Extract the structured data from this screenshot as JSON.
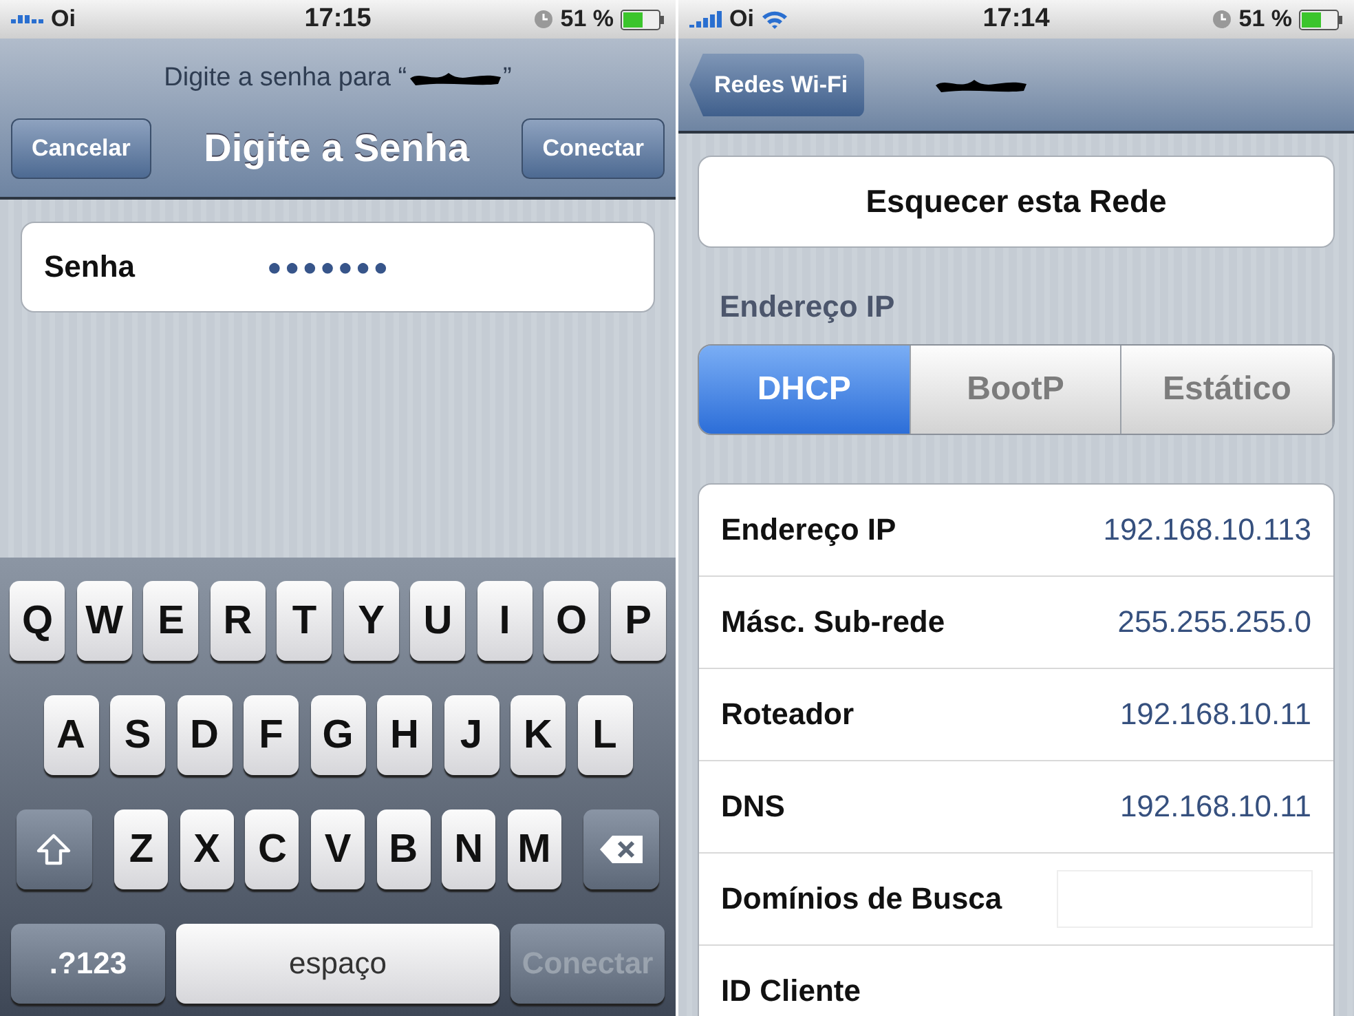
{
  "left_screen": {
    "status_bar": {
      "carrier": "Oi",
      "wifi": false,
      "time": "17:15",
      "battery": "51 %"
    },
    "nav": {
      "prompt_before": "Digite a senha para “",
      "prompt_after": "”",
      "title": "Digite a Senha",
      "left_button": "Cancelar",
      "right_button": "Conectar"
    },
    "password": {
      "label": "Senha",
      "value": "●●●●●●●"
    },
    "keyboard": {
      "rows": [
        [
          "Q",
          "W",
          "E",
          "R",
          "T",
          "Y",
          "U",
          "I",
          "O",
          "P"
        ],
        [
          "A",
          "S",
          "D",
          "F",
          "G",
          "H",
          "J",
          "K",
          "L"
        ],
        [
          "Z",
          "X",
          "C",
          "V",
          "B",
          "N",
          "M"
        ]
      ],
      "numbers_key": ".?123",
      "space_key": "espaço",
      "return_key": {
        "label": "Conectar",
        "disabled": true
      }
    }
  },
  "right_screen": {
    "status_bar": {
      "carrier": "Oi",
      "wifi": true,
      "time": "17:14",
      "battery": "51 %"
    },
    "nav": {
      "back_button": "Redes Wi-Fi"
    },
    "forget_button": "Esquecer esta Rede",
    "section_header": "Endereço IP",
    "segments": [
      {
        "label": "DHCP",
        "selected": true
      },
      {
        "label": "BootP",
        "selected": false
      },
      {
        "label": "Estático",
        "selected": false
      }
    ],
    "rows": [
      {
        "kind": "value",
        "label": "Endereço IP",
        "value": "192.168.10.113"
      },
      {
        "kind": "value",
        "label": "Másc. Sub-rede",
        "value": "255.255.255.0"
      },
      {
        "kind": "value",
        "label": "Roteador",
        "value": "192.168.10.11"
      },
      {
        "kind": "value",
        "label": "DNS",
        "value": "192.168.10.11"
      },
      {
        "kind": "field",
        "label": "Domínios de Busca"
      },
      {
        "kind": "label",
        "label": "ID Cliente"
      }
    ]
  }
}
